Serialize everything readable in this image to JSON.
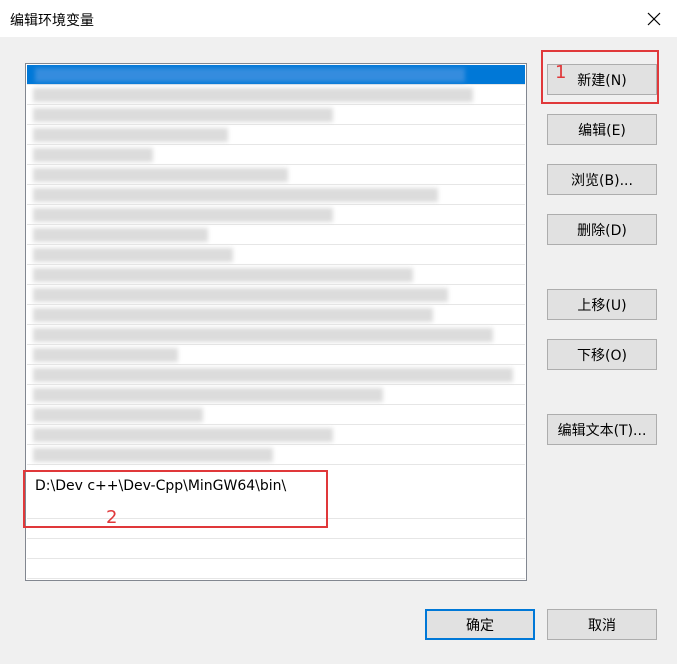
{
  "window": {
    "title": "编辑环境变量",
    "close_icon": "close-icon"
  },
  "list": {
    "new_entry": "D:\\Dev c++\\Dev-Cpp\\MinGW64\\bin\\"
  },
  "buttons": {
    "new": "新建(N)",
    "edit": "编辑(E)",
    "browse": "浏览(B)...",
    "delete": "删除(D)",
    "move_up": "上移(U)",
    "move_down": "下移(O)",
    "edit_text": "编辑文本(T)...",
    "ok": "确定",
    "cancel": "取消"
  },
  "annotations": {
    "label_1": "1",
    "label_2": "2",
    "color": "#e0383a"
  }
}
